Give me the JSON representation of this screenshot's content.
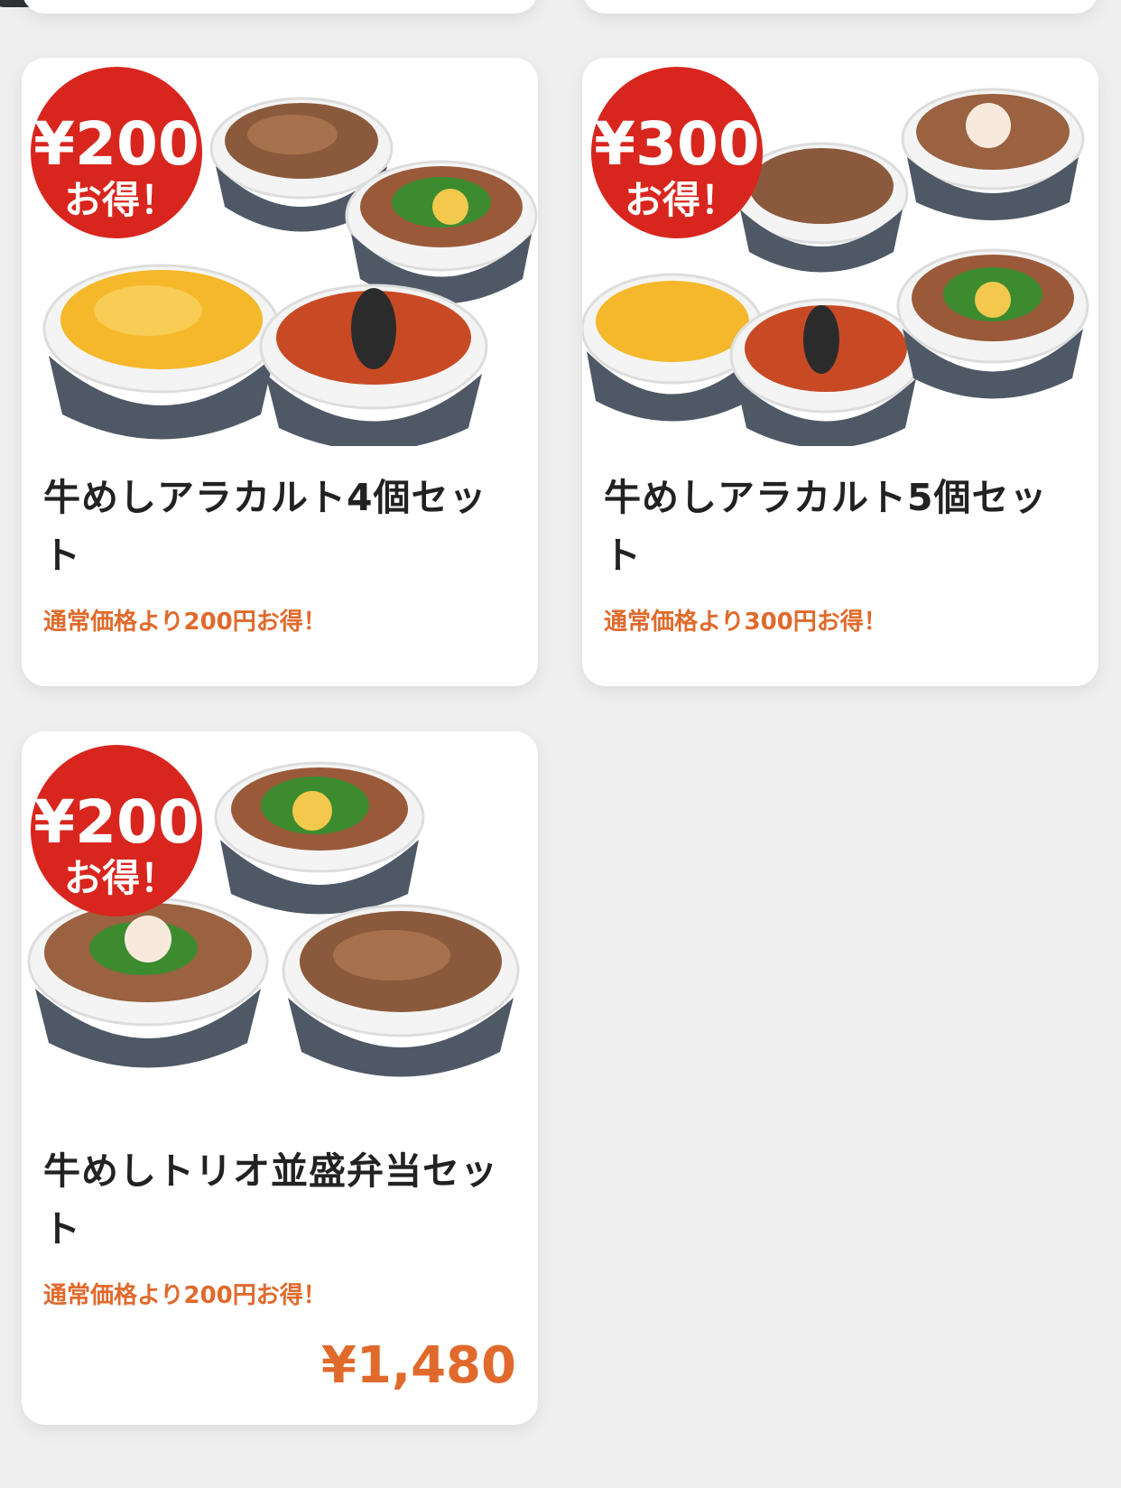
{
  "products": [
    {
      "name": "牛めしアラカルト4個セット",
      "promo": "通常価格より200円お得！",
      "badge_amount": "¥200",
      "badge_label": "お得！",
      "badge_color": "#d8261e"
    },
    {
      "name": "牛めしアラカルト5個セット",
      "promo": "通常価格より300円お得！",
      "badge_amount": "¥300",
      "badge_label": "お得！",
      "badge_color": "#d8261e"
    },
    {
      "name": "牛めしトリオ並盛弁当セット",
      "promo": "通常価格より200円お得！",
      "badge_amount": "¥200",
      "badge_label": "お得！",
      "badge_color": "#d8261e",
      "price": "¥1,480"
    }
  ],
  "colors": {
    "accent": "#e06a2c",
    "background": "#efefef",
    "card": "#ffffff",
    "title_text": "#222222"
  }
}
